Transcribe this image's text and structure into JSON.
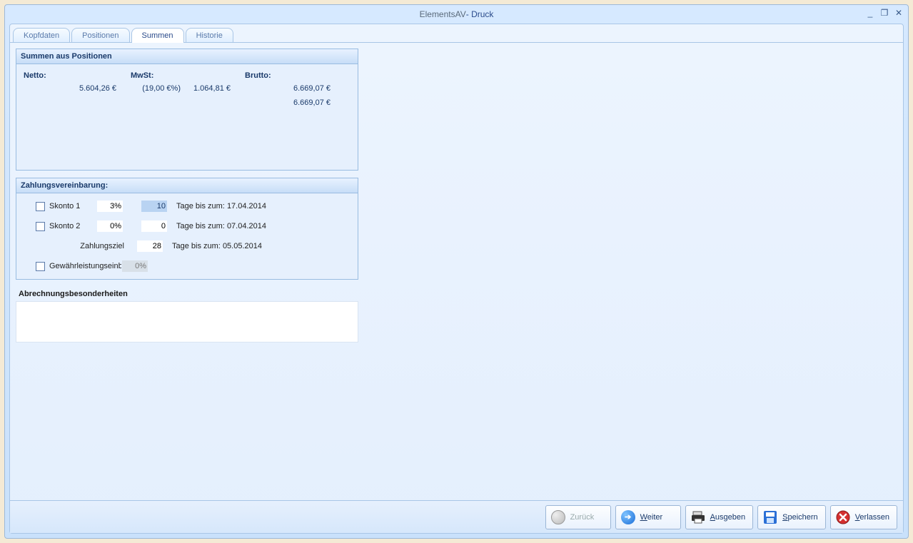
{
  "window": {
    "title_main": "ElementsAV",
    "title_sub": " - Druck"
  },
  "tabs": {
    "items": [
      {
        "label": "Kopfdaten"
      },
      {
        "label": "Positionen"
      },
      {
        "label": "Summen"
      },
      {
        "label": "Historie"
      }
    ],
    "active_index": 2
  },
  "sums": {
    "header": "Summen aus Positionen",
    "col_netto": "Netto:",
    "col_mwst": "MwSt:",
    "col_brutto": "Brutto:",
    "netto_value": "5.604,26 €",
    "mwst_rate": "(19,00 €%)",
    "mwst_value": "1.064,81 €",
    "brutto_value": "6.669,07 €",
    "brutto_total": "6.669,07 €"
  },
  "payment": {
    "header": "Zahlungsvereinbarung:",
    "skonto1": {
      "label": "Skonto 1",
      "percent": "3%",
      "days": "10",
      "date_label": "Tage bis zum:",
      "date": "17.04.2014"
    },
    "skonto2": {
      "label": "Skonto 2",
      "percent": "0%",
      "days": "0",
      "date_label": "Tage bis zum:",
      "date": "07.04.2014"
    },
    "ziel": {
      "label": "Zahlungsziel",
      "days": "28",
      "date_label": "Tage bis zum:",
      "date": "05.05.2014"
    },
    "einbehalt": {
      "label": "Gewährleistungseinbehalt:",
      "percent": "0%"
    }
  },
  "notes": {
    "header": "Abrechnungsbesonderheiten"
  },
  "footer": {
    "back": "Zurück",
    "forward": "Weiter",
    "output": "Ausgeben",
    "save": "Speichern",
    "exit": "Verlassen",
    "back_u": "Z",
    "forward_u": "W",
    "output_u": "A",
    "save_u": "S",
    "exit_u": "V"
  }
}
